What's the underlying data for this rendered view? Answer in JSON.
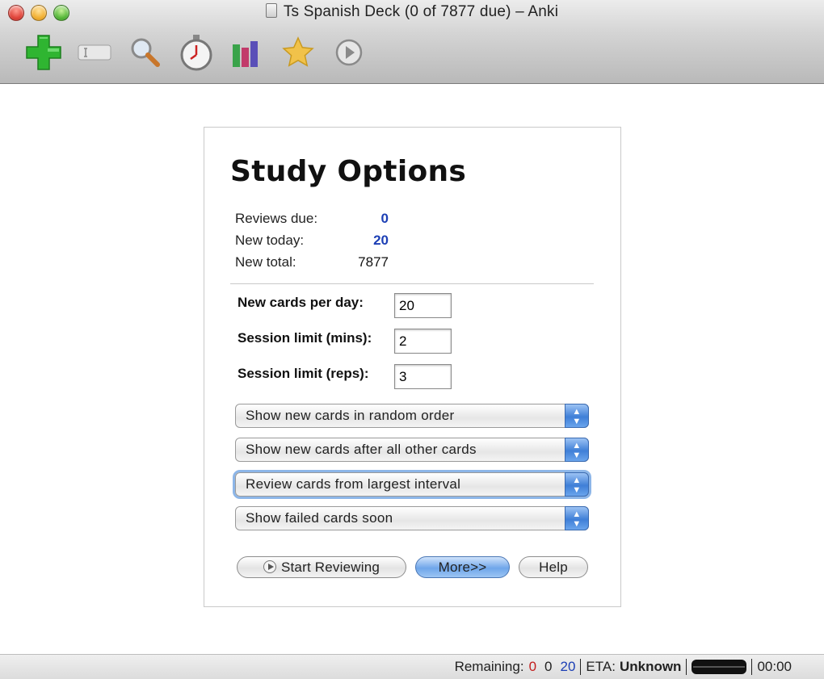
{
  "window": {
    "title": "Ts Spanish Deck (0 of 7877 due) – Anki"
  },
  "toolbar": {
    "items": [
      {
        "name": "add-icon"
      },
      {
        "name": "edit-icon"
      },
      {
        "name": "search-icon"
      },
      {
        "name": "timer-icon"
      },
      {
        "name": "graphs-icon"
      },
      {
        "name": "star-icon"
      },
      {
        "name": "play-icon"
      }
    ]
  },
  "study": {
    "title": "Study Options",
    "stats": [
      {
        "label": "Reviews due:",
        "value": "0"
      },
      {
        "label": "New today:",
        "value": "20"
      },
      {
        "label": "New total:",
        "value": "7877"
      }
    ],
    "fields": [
      {
        "label": "New cards per day:",
        "value": "20"
      },
      {
        "label": "Session limit (mins):",
        "value": "2"
      },
      {
        "label": "Session limit (reps):",
        "value": "3"
      }
    ],
    "selects": [
      "Show new cards in random order",
      "Show new cards after all other cards",
      "Review cards from largest interval",
      "Show failed cards soon"
    ],
    "buttons": {
      "start": "Start Reviewing",
      "more": "More>>",
      "help": "Help"
    }
  },
  "status": {
    "remaining_label": "Remaining:",
    "remaining_failed": "0",
    "remaining_review": "0",
    "remaining_new": "20",
    "eta_label": "ETA:",
    "eta_value": "Unknown",
    "timer": "00:00"
  },
  "colors": {
    "accent_blue": "#1c3fb5",
    "failed_red": "#c21d1d"
  }
}
